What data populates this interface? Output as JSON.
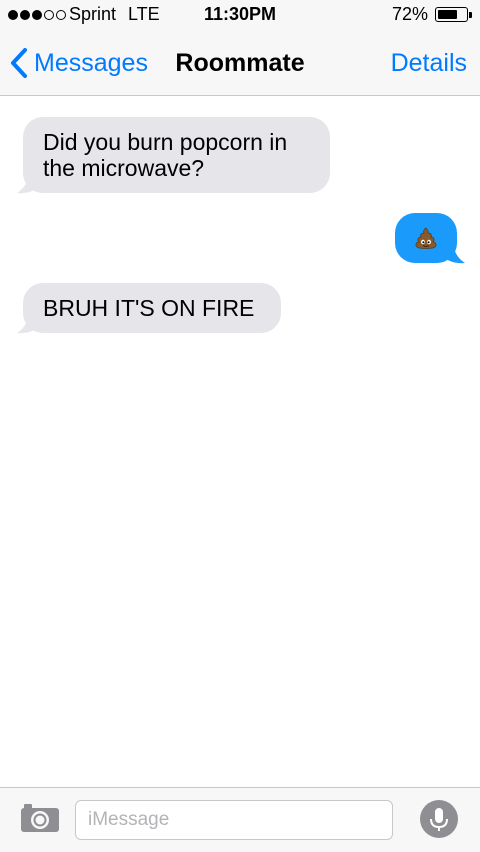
{
  "status_bar": {
    "carrier": "Sprint",
    "network": "LTE",
    "time": "11:30PM",
    "battery_percent": "72%",
    "battery_level": 0.72,
    "signal_bars_filled": 3,
    "signal_bars_total": 5
  },
  "nav": {
    "back_label": "Messages",
    "title": "Roommate",
    "details_label": "Details"
  },
  "messages": [
    {
      "direction": "received",
      "text": "Did you burn popcorn in the microwave?"
    },
    {
      "direction": "sent",
      "content": "poop-emoji"
    },
    {
      "direction": "received",
      "text": "BRUH IT'S ON FIRE"
    }
  ],
  "input_bar": {
    "placeholder": "iMessage",
    "value": "",
    "camera_icon": "camera-icon",
    "mic_icon": "microphone-icon"
  },
  "colors": {
    "accent": "#007aff",
    "sent_bubble": "#1a9bfc",
    "received_bubble": "#e5e5ea"
  }
}
